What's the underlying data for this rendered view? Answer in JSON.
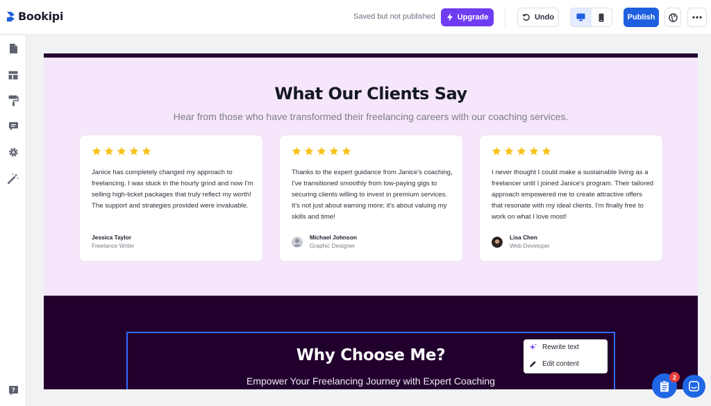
{
  "app": {
    "logo_text": "Bookipi"
  },
  "topbar": {
    "status": "Saved but not published",
    "upgrade_label": "Upgrade",
    "undo_label": "Undo",
    "publish_label": "Publish",
    "icons": [
      "lightning-icon",
      "undo-icon",
      "desktop-icon",
      "mobile-icon",
      "globe-icon",
      "more-icon"
    ],
    "active_device": "desktop"
  },
  "sidebar": {
    "items": [
      "page-icon",
      "layout-icon",
      "paint-roller-icon",
      "comment-icon",
      "gear-icon",
      "magic-wand-icon"
    ],
    "bottom": "help-icon"
  },
  "testimonials": {
    "title": "What Our Clients Say",
    "subtitle": "Hear from those who have transformed their freelancing careers with our coaching services.",
    "cards": [
      {
        "rating": 5,
        "quote": "Janice has completely changed my approach to freelancing. I was stuck in the hourly grind and now I'm selling high-ticket packages that truly reflect my worth! The support and strategies provided were invaluable.",
        "name": "Jessica Taylor",
        "role": "Freelance Writer"
      },
      {
        "rating": 5,
        "quote": "Thanks to the expert guidance from Janice's coaching, I've transitioned smoothly from low-paying gigs to securing clients willing to invest in premium services. It's not just about earning more; it's about valuing my skills and time!",
        "name": "Michael Johnson",
        "role": "Graphic Designer"
      },
      {
        "rating": 5,
        "quote": "I never thought I could make a sustainable living as a freelancer until I joined Janice's program. Their tailored approach empowered me to create attractive offers that resonate with my ideal clients. I'm finally free to work on what I love most!",
        "name": "Lisa Chen",
        "role": "Web Developer"
      }
    ]
  },
  "why": {
    "title": "Why Choose Me?",
    "subtitle": "Empower Your Freelancing Journey with Expert Coaching"
  },
  "context_menu": {
    "items": [
      {
        "label": "Rewrite text",
        "icon": "sparkle-icon"
      },
      {
        "label": "Edit content",
        "icon": "pencil-icon"
      }
    ]
  },
  "fab": {
    "badge_count": "2"
  },
  "colors": {
    "accent": "#1e5fe0",
    "upgrade": "#6e3df2",
    "hero_bg": "#f6e6fb",
    "dark_bg": "#22002e",
    "star": "#f8c21c"
  }
}
